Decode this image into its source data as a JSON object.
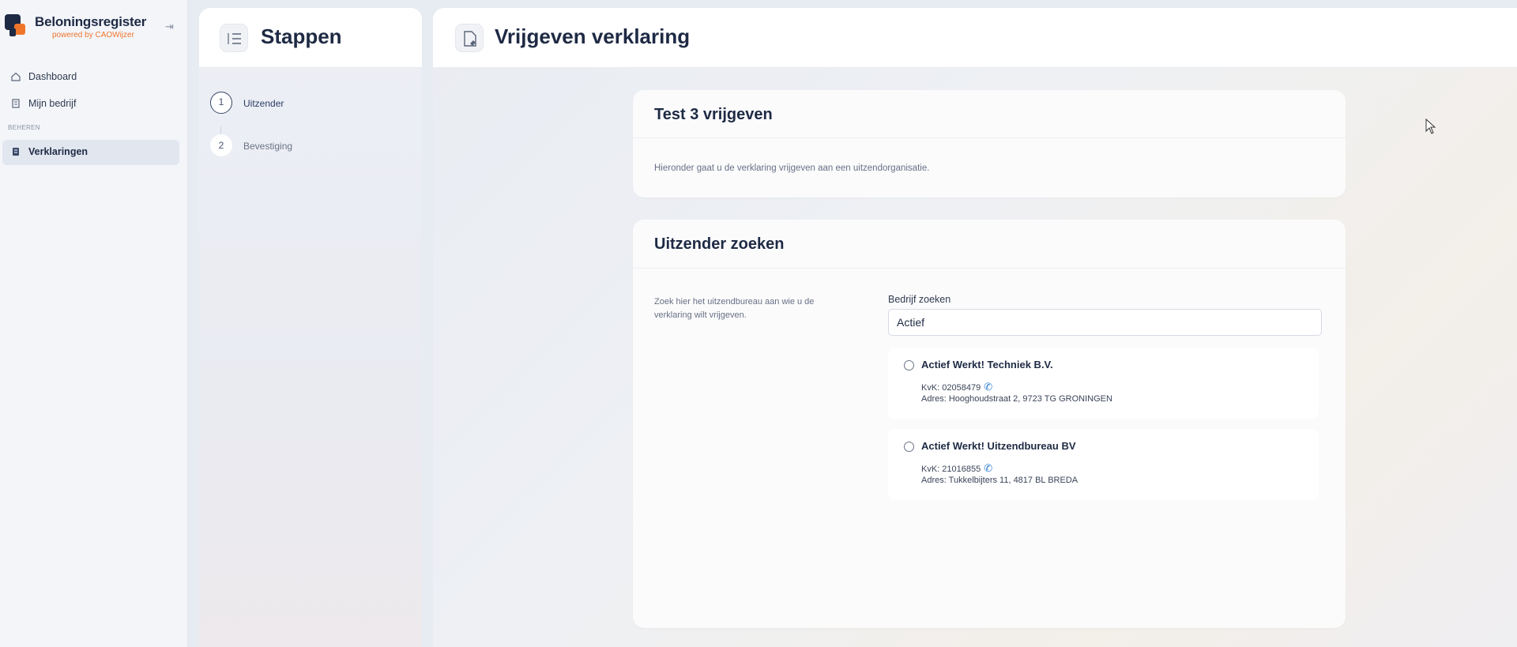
{
  "sidebar": {
    "brand_name": "Beloningsregister",
    "brand_sub": "powered by CAOWijzer",
    "collapse_icon": "collapse-sidebar-icon",
    "items": [
      {
        "label": "Dashboard",
        "icon": "home-icon"
      },
      {
        "label": "Mijn bedrijf",
        "icon": "building-icon"
      }
    ],
    "section_label": "BEHEREN",
    "section_items": [
      {
        "label": "Verklaringen",
        "icon": "document-icon",
        "active": true
      }
    ]
  },
  "steps": {
    "title": "Stappen",
    "icon": "list-icon",
    "items": [
      {
        "number": "1",
        "label": "Uitzender",
        "active": true
      },
      {
        "number": "2",
        "label": "Bevestiging",
        "active": false
      }
    ]
  },
  "main": {
    "title": "Vrijgeven verklaring",
    "icon": "document-edit-icon"
  },
  "intro_card": {
    "title": "Test 3 vrijgeven",
    "text": "Hieronder gaat u de verklaring vrijgeven aan een uitzendorganisatie."
  },
  "search_card": {
    "title": "Uitzender zoeken",
    "description": "Zoek hier het uitzendbureau aan wie u de verklaring wilt vrijgeven.",
    "search_label": "Bedrijf zoeken",
    "search_value": "Actief",
    "results": [
      {
        "name": "Actief Werkt! Techniek B.V.",
        "kvk": "KvK: 02058479",
        "address": "Adres: Hooghoudstraat 2, 9723 TG GRONINGEN"
      },
      {
        "name": "Actief Werkt! Uitzendbureau BV",
        "kvk": "KvK: 21016855",
        "address": "Adres: Tukkelbijters 11, 4817 BL BREDA"
      }
    ]
  },
  "colors": {
    "accent_orange": "#f0752c",
    "brand_navy": "#1e2a44",
    "phone_blue": "#2f7fd1"
  }
}
